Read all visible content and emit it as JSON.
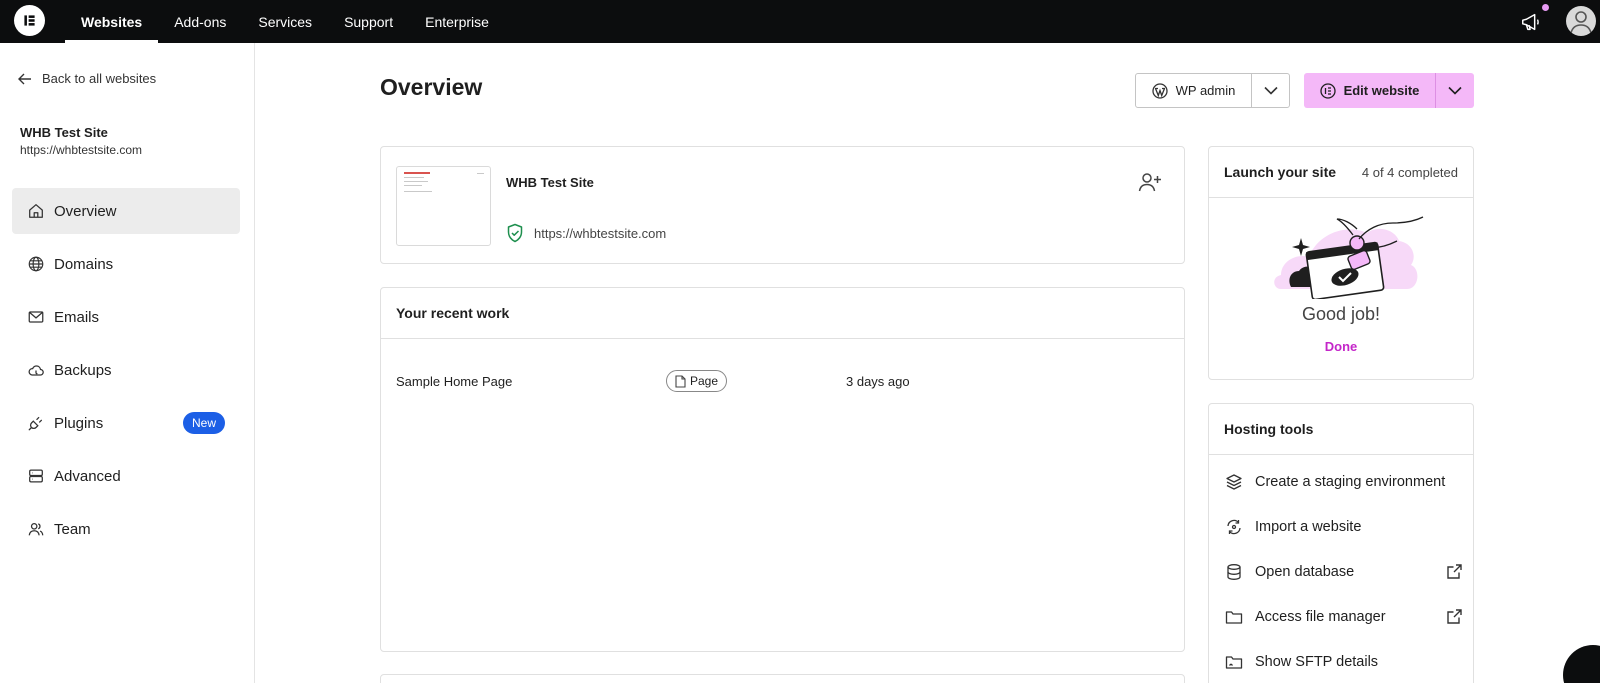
{
  "topnav": {
    "logo_icon": "elementor-logo-icon",
    "items": [
      {
        "label": "Websites",
        "active": true
      },
      {
        "label": "Add-ons"
      },
      {
        "label": "Services"
      },
      {
        "label": "Support"
      },
      {
        "label": "Enterprise"
      }
    ],
    "notification_icon": "megaphone-icon",
    "notification_dot_color": "#e89bf3",
    "user_icon": "user-avatar-icon"
  },
  "sidebar": {
    "back_label": "Back to all websites",
    "site_name": "WHB Test Site",
    "site_url": "https://whbtestsite.com",
    "items": [
      {
        "label": "Overview",
        "icon": "home-icon",
        "active": true
      },
      {
        "label": "Domains",
        "icon": "globe-icon"
      },
      {
        "label": "Emails",
        "icon": "mail-icon"
      },
      {
        "label": "Backups",
        "icon": "cloud-icon"
      },
      {
        "label": "Plugins",
        "icon": "plug-icon",
        "badge": "New"
      },
      {
        "label": "Advanced",
        "icon": "server-icon"
      },
      {
        "label": "Team",
        "icon": "team-icon"
      }
    ]
  },
  "header": {
    "title": "Overview",
    "wp_admin_label": "WP admin",
    "edit_website_label": "Edit website",
    "accent_color": "#f4b8f8"
  },
  "site_card": {
    "name": "WHB Test Site",
    "url": "https://whbtestsite.com"
  },
  "recent_work": {
    "title": "Your recent work",
    "rows": [
      {
        "name": "Sample Home Page",
        "type": "Page",
        "when": "3 days ago"
      }
    ]
  },
  "launch": {
    "title": "Launch your site",
    "progress": "4 of 4 completed",
    "message": "Good job!",
    "status": "Done",
    "status_color": "#c426c9"
  },
  "hosting_tools": {
    "title": "Hosting tools",
    "items": [
      {
        "label": "Create a staging environment",
        "icon": "layers-icon"
      },
      {
        "label": "Import a website",
        "icon": "import-icon"
      },
      {
        "label": "Open database",
        "icon": "database-icon",
        "external": true
      },
      {
        "label": "Access file manager",
        "icon": "folder-icon",
        "external": true
      },
      {
        "label": "Show SFTP details",
        "icon": "folder-sync-icon"
      }
    ]
  }
}
